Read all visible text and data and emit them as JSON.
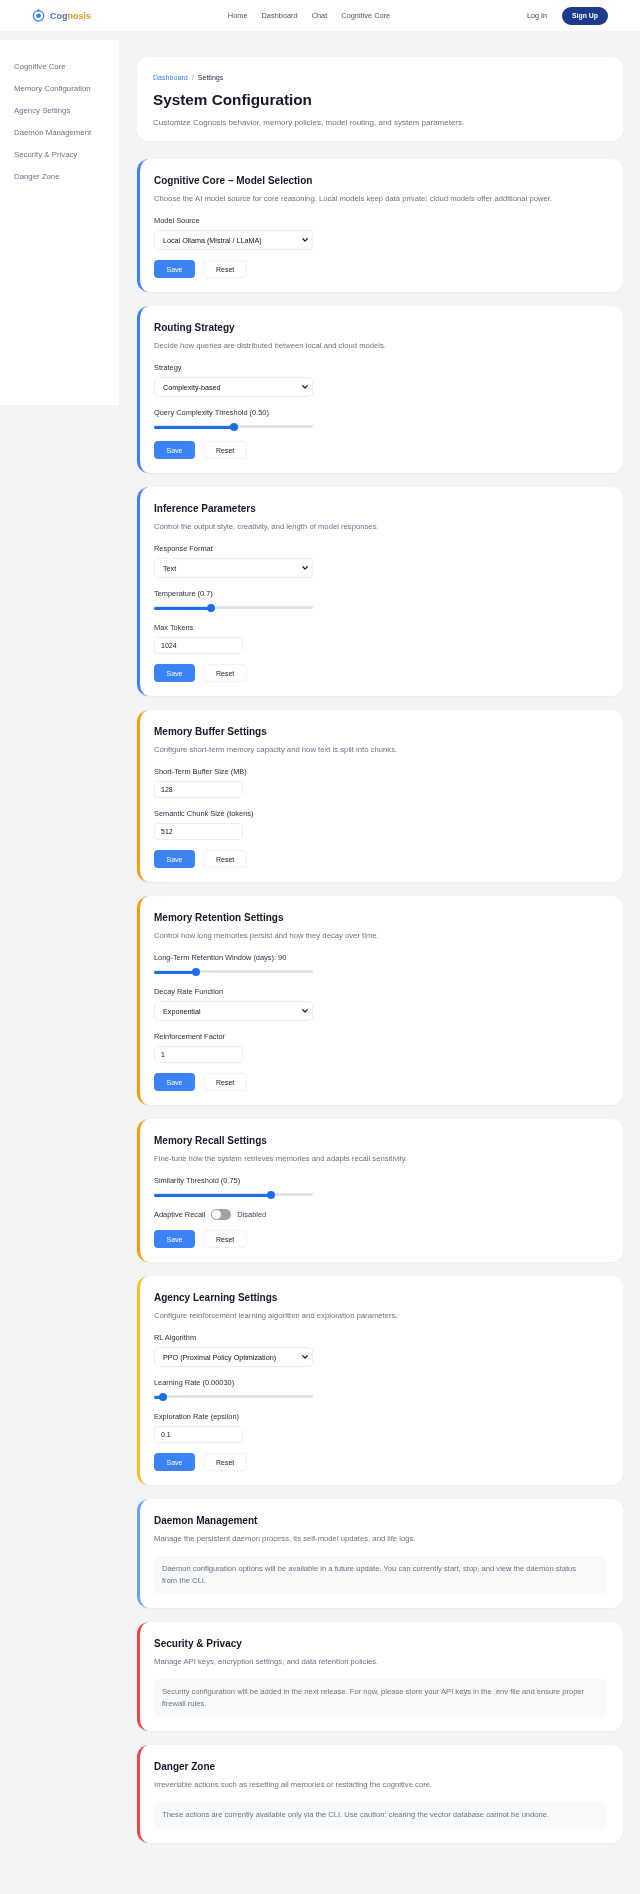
{
  "header": {
    "brand": [
      "Cog",
      "nosis"
    ],
    "nav": [
      {
        "label": "Home",
        "selected": false
      },
      {
        "label": "Dashboard",
        "selected": false
      },
      {
        "label": "Chat",
        "selected": false
      },
      {
        "label": "Cognitive Core",
        "selected": false
      }
    ],
    "login": "Log In",
    "signup": "Sign Up"
  },
  "sidebar": {
    "items": [
      {
        "label": "Cognitive Core",
        "selected": false
      },
      {
        "label": "Memory Configuration",
        "selected": false
      },
      {
        "label": "Agency Settings",
        "selected": false
      },
      {
        "label": "Daemon Management",
        "selected": false
      },
      {
        "label": "Security & Privacy",
        "selected": false
      },
      {
        "label": "Danger Zone",
        "selected": false
      }
    ]
  },
  "intro": {
    "breadcrumb": [
      {
        "kind": "link",
        "label": "Dashboard"
      },
      {
        "kind": "separator",
        "label": "/"
      },
      {
        "kind": "current",
        "label": "Settings"
      }
    ],
    "title": "System Configuration",
    "subtitle": "Customize Cognosis behavior, memory policies, model routing, and system parameters."
  },
  "sections": [
    {
      "title": "Cognitive Core – Model Selection",
      "description": "Choose the AI model source for core reasoning. Local models keep data private; cloud models offer additional power.",
      "color": "#3b82f6",
      "fields": [
        {
          "kind": "select",
          "label": "Model Source",
          "value": "Local Ollama (Mistral / LLaMA)"
        }
      ],
      "actions": [
        {
          "kind": "primary",
          "label": "Save"
        },
        {
          "kind": "secondary",
          "label": "Reset"
        }
      ]
    },
    {
      "title": "Routing Strategy",
      "description": "Decide how queries are distributed between local and cloud models.",
      "color": "#3b82f6",
      "fields": [
        {
          "kind": "select",
          "label": "Strategy",
          "value": "Complexity-based"
        },
        {
          "kind": "slider",
          "label": "Query Complexity Threshold (0.50)",
          "level": 0.5
        }
      ],
      "actions": [
        {
          "kind": "primary",
          "label": "Save"
        },
        {
          "kind": "secondary",
          "label": "Reset"
        }
      ]
    },
    {
      "title": "Inference Parameters",
      "description": "Control the output style, creativity, and length of model responses.",
      "color": "#3b82f6",
      "fields": [
        {
          "kind": "select",
          "label": "Response Format",
          "value": "Text"
        },
        {
          "kind": "slider",
          "label": "Temperature (0.7)",
          "level": 0.35
        },
        {
          "kind": "number",
          "label": "Max Tokens",
          "value": "1024"
        }
      ],
      "actions": [
        {
          "kind": "primary",
          "label": "Save"
        },
        {
          "kind": "secondary",
          "label": "Reset"
        }
      ]
    },
    {
      "title": "Memory Buffer Settings",
      "description": "Configure short-term memory capacity and how text is split into chunks.",
      "color": "#f59e0b",
      "fields": [
        {
          "kind": "number",
          "label": "Short-Term Buffer Size (MB)",
          "value": "128"
        },
        {
          "kind": "number",
          "label": "Semantic Chunk Size (tokens)",
          "value": "512"
        }
      ],
      "actions": [
        {
          "kind": "primary",
          "label": "Save"
        },
        {
          "kind": "secondary",
          "label": "Reset"
        }
      ]
    },
    {
      "title": "Memory Retention Settings",
      "description": "Control how long memories persist and how they decay over time.",
      "color": "#f59e0b",
      "fields": [
        {
          "kind": "slider",
          "label": "Long-Term Retention Window (days): 90",
          "level": 0.25
        },
        {
          "kind": "select",
          "label": "Decay Rate Function",
          "value": "Exponential"
        },
        {
          "kind": "number",
          "label": "Reinforcement Factor",
          "value": "1"
        }
      ],
      "actions": [
        {
          "kind": "primary",
          "label": "Save"
        },
        {
          "kind": "secondary",
          "label": "Reset"
        }
      ]
    },
    {
      "title": "Memory Recall Settings",
      "description": "Fine-tune how the system retrieves memories and adapts recall sensitivity.",
      "color": "#f59e0b",
      "fields": [
        {
          "kind": "slider",
          "label": "Similarity Threshold (0.75)",
          "level": 0.75
        },
        {
          "kind": "toggle",
          "label": "Adaptive Recall",
          "on": false,
          "state_label": "Disabled"
        }
      ],
      "actions": [
        {
          "kind": "primary",
          "label": "Save"
        },
        {
          "kind": "secondary",
          "label": "Reset"
        }
      ]
    },
    {
      "title": "Agency Learning Settings",
      "description": "Configure reinforcement learning algorithm and exploration parameters.",
      "color": "#fbbf24",
      "fields": [
        {
          "kind": "select",
          "label": "RL Algorithm",
          "value": "PPO (Proximal Policy Optimization)"
        },
        {
          "kind": "slider",
          "label": "Learning Rate (0.00030)",
          "level": 0.03
        },
        {
          "kind": "number",
          "label": "Exploration Rate (epsilon)",
          "value": "0.1"
        }
      ],
      "actions": [
        {
          "kind": "primary",
          "label": "Save"
        },
        {
          "kind": "secondary",
          "label": "Reset"
        }
      ]
    },
    {
      "title": "Daemon Management",
      "description": "Manage the persistent daemon process, its self-model updates, and life logs.",
      "color": "#60a5fa",
      "note": "Daemon configuration options will be available in a future update. You can currently start, stop, and view the daemon status from the CLI."
    },
    {
      "title": "Security & Privacy",
      "description": "Manage API keys, encryption settings, and data retention policies.",
      "color": "#ef4444",
      "note": "Security configuration will be added in the next release. For now, please store your API keys in the .env file and ensure proper firewall rules."
    },
    {
      "title": "Danger Zone",
      "description": "Irreversible actions such as resetting all memories or restarting the cognitive core.",
      "color": "#ef4444",
      "note": "These actions are currently available only via the CLI. Use caution: clearing the vector database cannot be undone."
    }
  ]
}
